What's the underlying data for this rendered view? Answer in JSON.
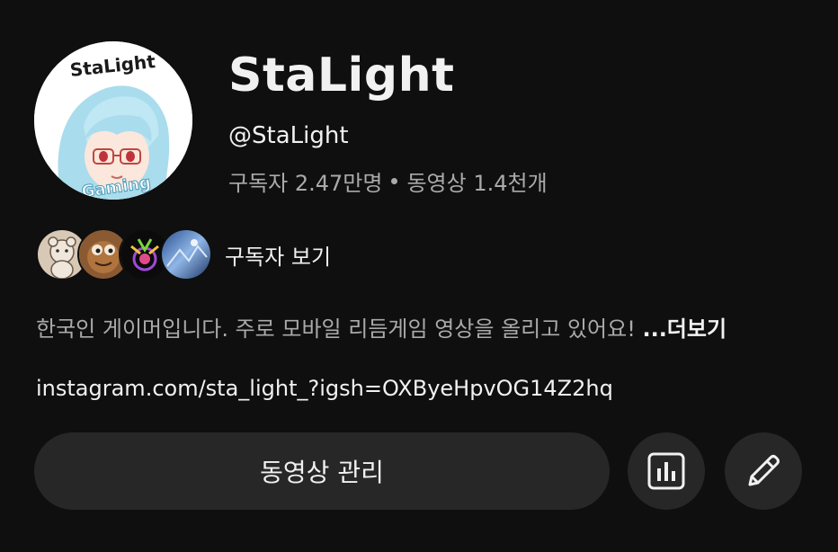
{
  "channel": {
    "name": "StaLight",
    "handle": "@StaLight",
    "subscribers": "구독자 2.47만명",
    "videos": "동영상 1.4천개",
    "avatar_text_top": "StaLight",
    "avatar_text_bottom": "Gaming"
  },
  "subscribers_row": {
    "label": "구독자 보기",
    "avatars": [
      "sub-avatar-bear",
      "sub-avatar-cartoon",
      "sub-avatar-neon",
      "sub-avatar-blue"
    ]
  },
  "description": {
    "text": "한국인 게이머입니다. 주로 모바일 리듬게임 영상을 올리고 있어요! ",
    "more": "...더보기"
  },
  "link": {
    "text": "instagram.com/sta_light_?igsh=OXByeHpvOG14Z2hq"
  },
  "actions": {
    "manage_videos": "동영상 관리",
    "analytics_icon": "bar-chart-icon",
    "edit_icon": "pencil-icon"
  },
  "colors": {
    "background": "#0f0f0f",
    "primary_text": "#f1f1f1",
    "secondary_text": "#aaaaaa",
    "button_bg": "#272727"
  }
}
